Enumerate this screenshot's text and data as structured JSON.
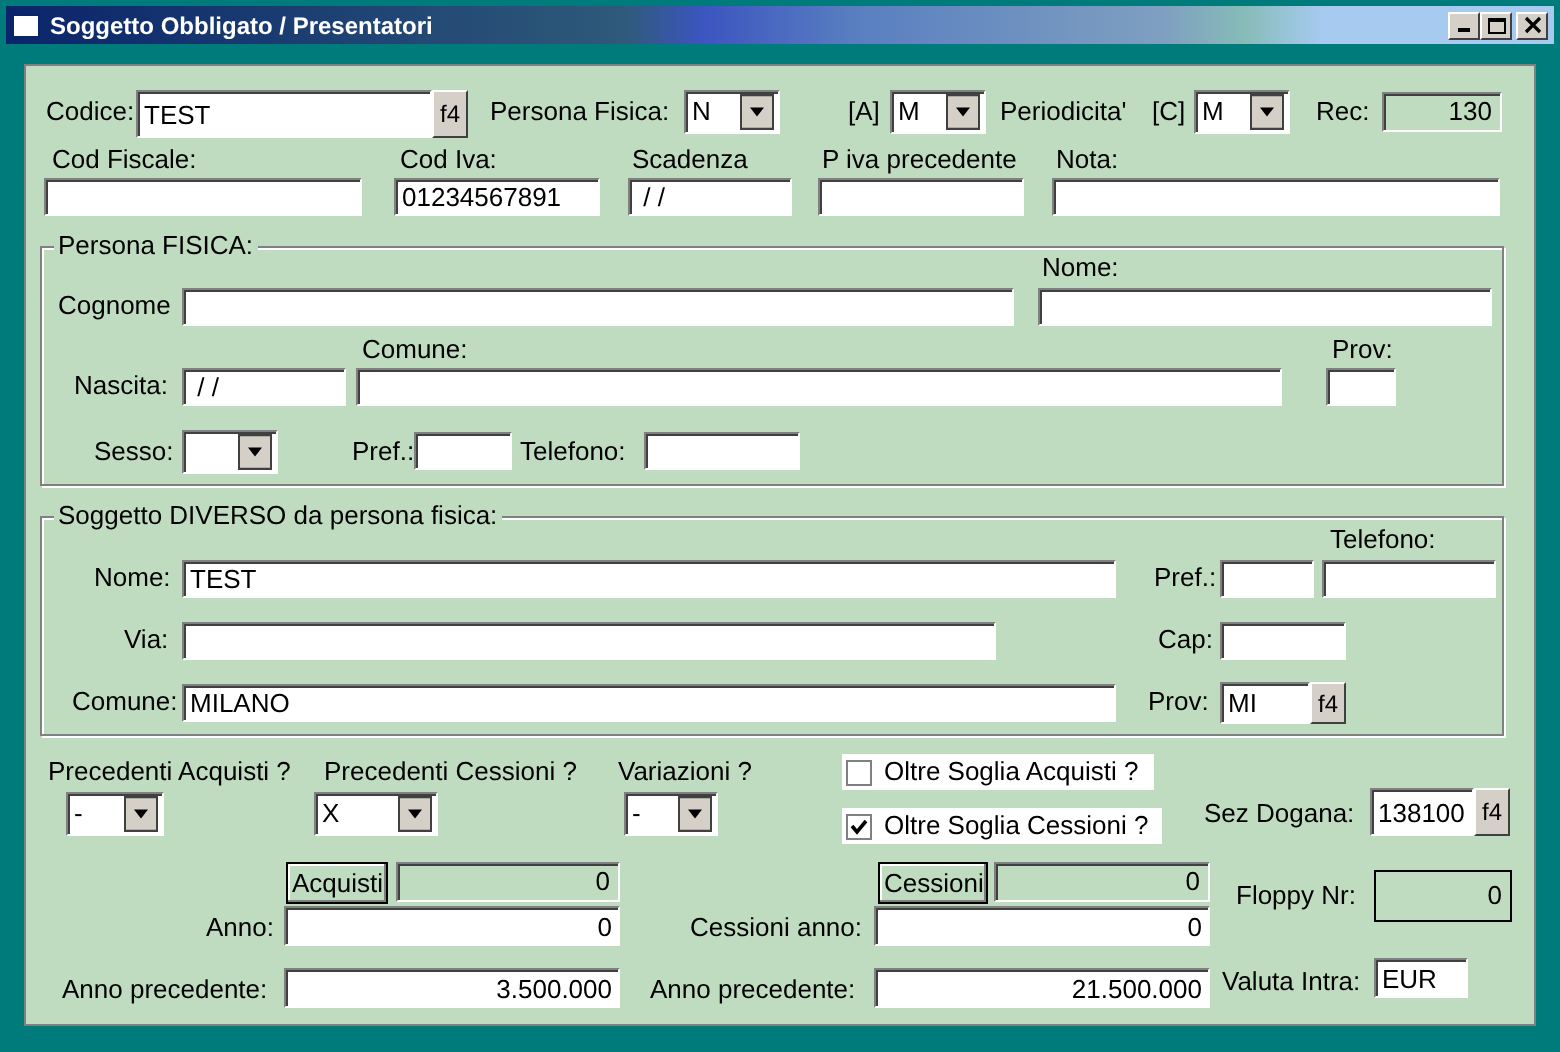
{
  "window": {
    "title": "Soggetto Obbligato / Presentatori"
  },
  "top": [
    {
      "kind": "label",
      "text": "Codice:"
    },
    {
      "kind": "field",
      "value": "TEST",
      "button": "f4"
    },
    {
      "kind": "label",
      "text": "Persona Fisica:"
    },
    {
      "kind": "select",
      "value": "N"
    },
    {
      "kind": "label",
      "text": "[A]"
    },
    {
      "kind": "select",
      "value": "M"
    },
    {
      "kind": "label",
      "text": "Periodicita'"
    },
    {
      "kind": "label",
      "text": "[C]"
    },
    {
      "kind": "select",
      "value": "M"
    },
    {
      "kind": "label",
      "text": "Rec:"
    },
    {
      "kind": "display",
      "value": "130"
    },
    {
      "kind": "label",
      "text": "Cod Fiscale:"
    },
    {
      "kind": "label",
      "text": "Cod Iva:"
    },
    {
      "kind": "label",
      "text": "Scadenza"
    },
    {
      "kind": "label",
      "text": "P iva precedente"
    },
    {
      "kind": "label",
      "text": "Nota:"
    },
    {
      "kind": "field"
    },
    {
      "kind": "field",
      "value": "01234567891"
    },
    {
      "kind": "field",
      "value": " / /"
    },
    {
      "kind": "field"
    },
    {
      "kind": "field"
    }
  ],
  "persona_fisica": {
    "legend": "Persona FISICA:",
    "items": [
      {
        "kind": "label",
        "text": "Nome:"
      },
      {
        "kind": "label",
        "text": "Cognome"
      },
      {
        "kind": "field"
      },
      {
        "kind": "field"
      },
      {
        "kind": "label",
        "text": "Comune:"
      },
      {
        "kind": "label",
        "text": "Prov:"
      },
      {
        "kind": "label",
        "text": "Nascita:"
      },
      {
        "kind": "field",
        "value": " / /"
      },
      {
        "kind": "field"
      },
      {
        "kind": "field"
      },
      {
        "kind": "label",
        "text": "Sesso:"
      },
      {
        "kind": "select"
      },
      {
        "kind": "label",
        "text": "Pref.:"
      },
      {
        "kind": "field"
      },
      {
        "kind": "label",
        "text": "Telefono:"
      },
      {
        "kind": "field"
      }
    ]
  },
  "soggetto_diverso": {
    "legend": "Soggetto DIVERSO da persona fisica:",
    "items": [
      {
        "kind": "label",
        "text": "Telefono:"
      },
      {
        "kind": "label",
        "text": "Nome:"
      },
      {
        "kind": "field",
        "value": "TEST"
      },
      {
        "kind": "label",
        "text": "Pref.:"
      },
      {
        "kind": "field"
      },
      {
        "kind": "field"
      },
      {
        "kind": "label",
        "text": "Via:"
      },
      {
        "kind": "field"
      },
      {
        "kind": "label",
        "text": "Cap:"
      },
      {
        "kind": "field"
      },
      {
        "kind": "label",
        "text": "Comune:"
      },
      {
        "kind": "field",
        "value": "MILANO"
      },
      {
        "kind": "label",
        "text": "Prov:"
      },
      {
        "kind": "field",
        "value": "MI",
        "button": "f4"
      }
    ]
  },
  "bottom": [
    {
      "kind": "label",
      "text": "Precedenti Acquisti ?"
    },
    {
      "kind": "label",
      "text": "Precedenti Cessioni ?"
    },
    {
      "kind": "label",
      "text": "Variazioni ?"
    },
    {
      "kind": "select",
      "value": "-"
    },
    {
      "kind": "select",
      "value": "X"
    },
    {
      "kind": "select",
      "value": "-"
    },
    {
      "kind": "checkbox",
      "text": "Oltre Soglia Acquisti ?",
      "checked": false
    },
    {
      "kind": "checkbox",
      "text": "Oltre Soglia Cessioni ?",
      "checked": true
    },
    {
      "kind": "label",
      "text": "Sez Dogana:"
    },
    {
      "kind": "field",
      "value": "138100",
      "button": "f4"
    },
    {
      "kind": "button",
      "text": "Acquisti"
    },
    {
      "kind": "display",
      "value": "0"
    },
    {
      "kind": "button",
      "text": "Cessioni"
    },
    {
      "kind": "display",
      "value": "0"
    },
    {
      "kind": "label",
      "text": "Floppy Nr:"
    },
    {
      "kind": "display",
      "value": "0"
    },
    {
      "kind": "label",
      "text": "Anno:"
    },
    {
      "kind": "field",
      "value": "0"
    },
    {
      "kind": "label",
      "text": "Cessioni anno:"
    },
    {
      "kind": "field",
      "value": "0"
    },
    {
      "kind": "label",
      "text": "Anno precedente:"
    },
    {
      "kind": "field",
      "value": "3.500.000"
    },
    {
      "kind": "label",
      "text": "Anno precedente:"
    },
    {
      "kind": "field",
      "value": "21.500.000"
    },
    {
      "kind": "label",
      "text": "Valuta Intra:"
    },
    {
      "kind": "field",
      "value": "EUR"
    }
  ]
}
